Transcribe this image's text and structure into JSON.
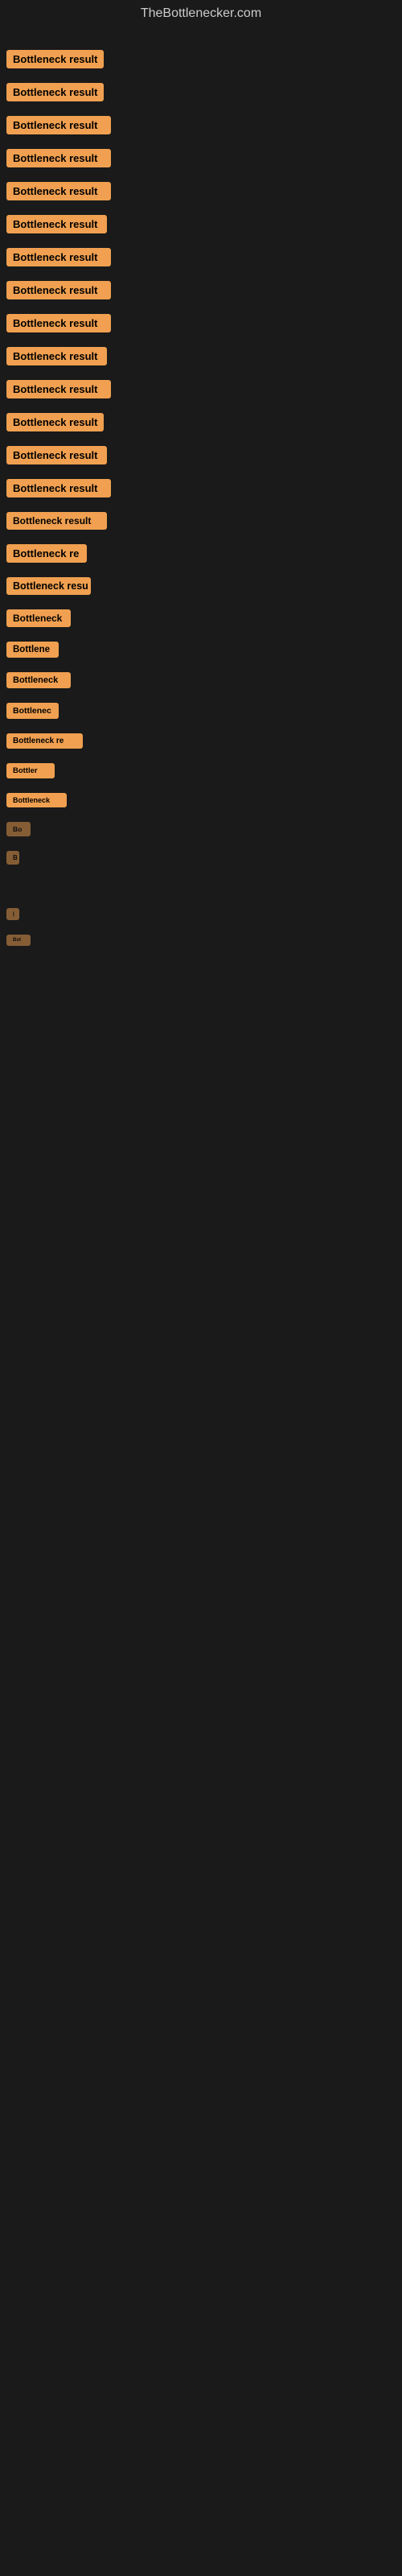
{
  "site": {
    "title": "TheBottlenecker.com"
  },
  "items": [
    {
      "label": "Bottleneck result",
      "id": 1
    },
    {
      "label": "Bottleneck result",
      "id": 2
    },
    {
      "label": "Bottleneck result",
      "id": 3
    },
    {
      "label": "Bottleneck result",
      "id": 4
    },
    {
      "label": "Bottleneck result",
      "id": 5
    },
    {
      "label": "Bottleneck result",
      "id": 6
    },
    {
      "label": "Bottleneck result",
      "id": 7
    },
    {
      "label": "Bottleneck result",
      "id": 8
    },
    {
      "label": "Bottleneck result",
      "id": 9
    },
    {
      "label": "Bottleneck result",
      "id": 10
    },
    {
      "label": "Bottleneck result",
      "id": 11
    },
    {
      "label": "Bottleneck result",
      "id": 12
    },
    {
      "label": "Bottleneck result",
      "id": 13
    },
    {
      "label": "Bottleneck result",
      "id": 14
    },
    {
      "label": "Bottleneck result",
      "id": 15
    },
    {
      "label": "Bottleneck re",
      "id": 16
    },
    {
      "label": "Bottleneck resu",
      "id": 17
    },
    {
      "label": "Bottleneck",
      "id": 18
    },
    {
      "label": "Bottlene",
      "id": 19
    },
    {
      "label": "Bottleneck",
      "id": 20
    },
    {
      "label": "Bottlenec",
      "id": 21
    },
    {
      "label": "Bottleneck re",
      "id": 22
    },
    {
      "label": "Bottler",
      "id": 23
    },
    {
      "label": "Bottleneck",
      "id": 24
    },
    {
      "label": "Bo",
      "id": 25
    },
    {
      "label": "B",
      "id": 26
    },
    {
      "label": "",
      "id": 27
    },
    {
      "label": "",
      "id": 28
    },
    {
      "label": "|",
      "id": 29
    },
    {
      "label": "Bot",
      "id": 30
    },
    {
      "label": "",
      "id": 31
    },
    {
      "label": "",
      "id": 32
    },
    {
      "label": "",
      "id": 33
    },
    {
      "label": "",
      "id": 34
    },
    {
      "label": "",
      "id": 35
    }
  ]
}
